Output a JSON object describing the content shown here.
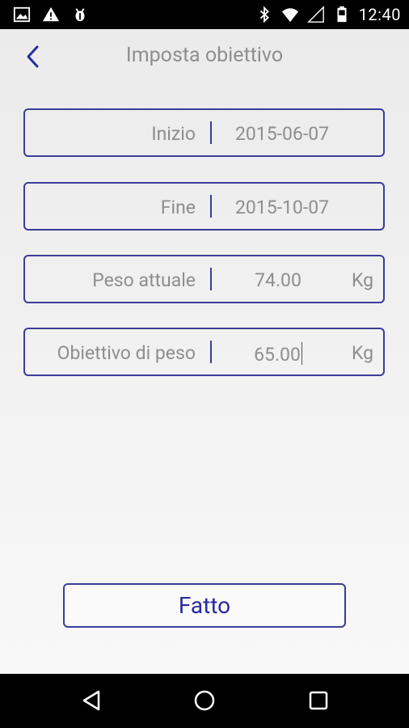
{
  "status_bar": {
    "time": "12:40",
    "left_icons": [
      "image-icon",
      "warning-icon",
      "android-debug-icon"
    ],
    "right_icons": [
      "bluetooth-icon",
      "wifi-icon",
      "signal-icon",
      "battery-icon"
    ]
  },
  "header": {
    "title": "Imposta obiettivo",
    "back_icon": "chevron-left-icon"
  },
  "form": {
    "start": {
      "label": "Inizio",
      "value": "2015-06-07"
    },
    "end": {
      "label": "Fine",
      "value": "2015-10-07"
    },
    "current_weight": {
      "label": "Peso attuale",
      "value": "74.00",
      "unit": "Kg"
    },
    "target_weight": {
      "label": "Obiettivo di peso",
      "value": "65.00",
      "unit": "Kg"
    }
  },
  "done_button": {
    "label": "Fatto"
  },
  "nav_bar": {
    "icons": [
      "back-triangle-icon",
      "home-circle-icon",
      "recents-square-icon"
    ]
  },
  "colors": {
    "accent": "#3c3c9a",
    "button_text": "#2a2aa0",
    "text_grey": "#8e8e8e"
  }
}
